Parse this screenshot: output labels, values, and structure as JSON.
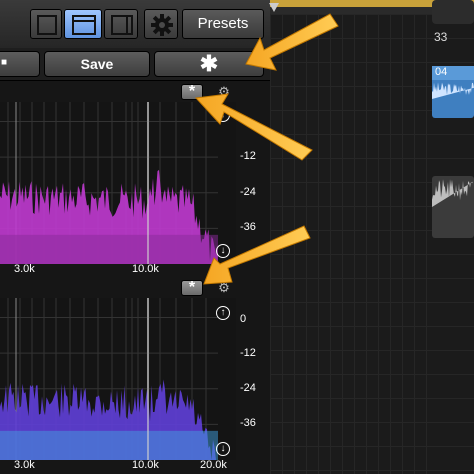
{
  "toolbar": {
    "presets_label": "Presets",
    "view_buttons": [
      "single-view",
      "split-view",
      "side-view"
    ],
    "settings_icon": "gear-icon"
  },
  "row2": {
    "save_label": "Save",
    "asterisk_label": "✱"
  },
  "chart_top": {
    "y_ticks": [
      "-12",
      "-24",
      "-36"
    ],
    "x_ticks": [
      "3.0k",
      "10.0k"
    ],
    "asterisk_label": "*",
    "reset_icon": "↑",
    "down_icon": "↓"
  },
  "chart_bottom": {
    "y_ticks": [
      "0",
      "-12",
      "-24",
      "-36"
    ],
    "x_ticks": [
      "3.0k",
      "10.0k",
      "20.0k"
    ],
    "asterisk_label": "*",
    "reset_icon": "↑",
    "down_icon": "↓"
  },
  "arrange": {
    "bar_label": "33",
    "region_label": "04"
  },
  "colors": {
    "accent_blue": "#6f9ff0",
    "magenta_fill": "#c03ad0",
    "purple_fill": "#5f3fd8",
    "arrow_orange": "#f5a623",
    "region_blue": "#3f7fc0"
  }
}
